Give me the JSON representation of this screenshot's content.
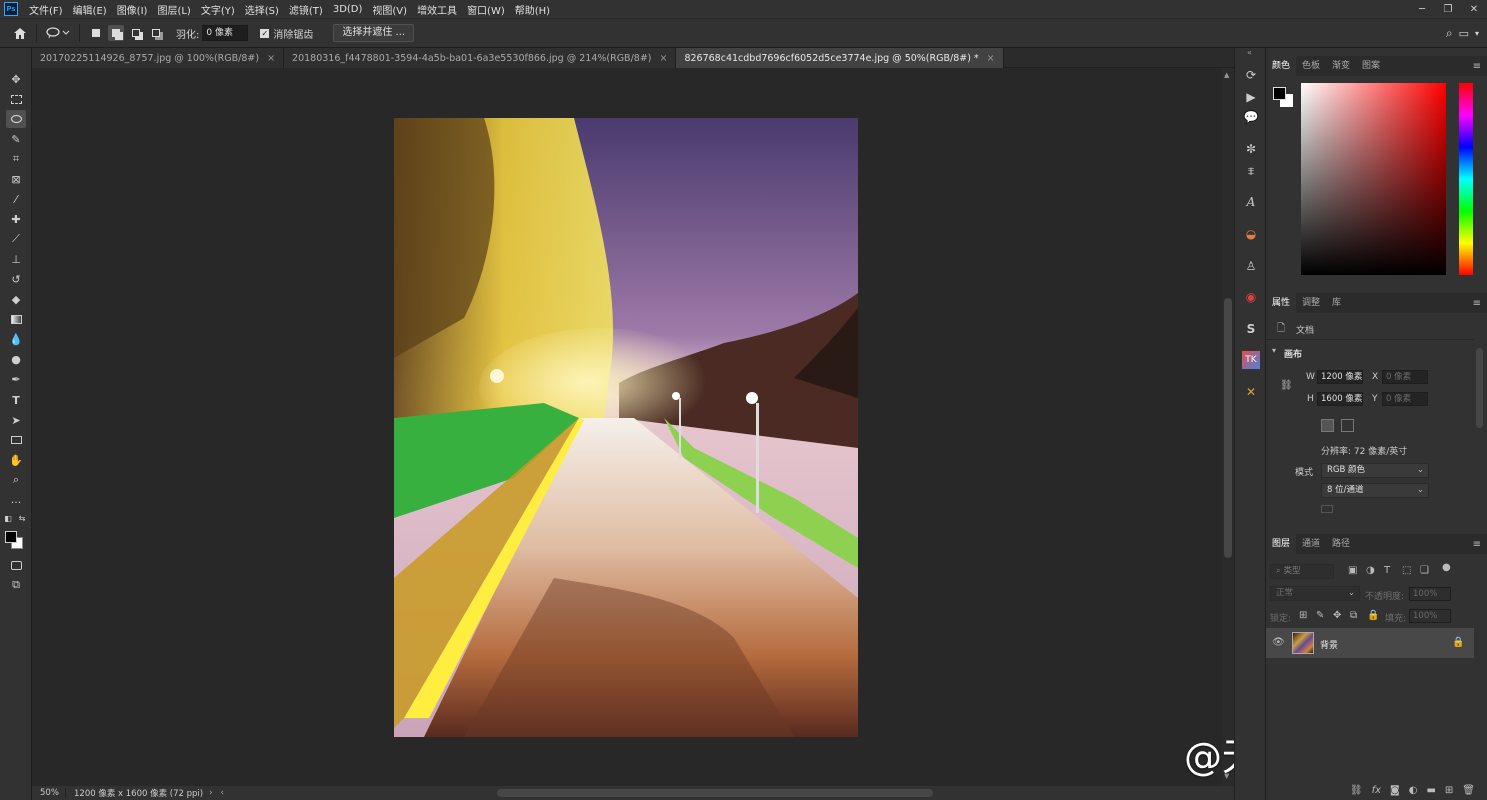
{
  "app": {
    "logo": "Ps"
  },
  "menu": [
    "文件(F)",
    "编辑(E)",
    "图像(I)",
    "图层(L)",
    "文字(Y)",
    "选择(S)",
    "滤镜(T)",
    "3D(D)",
    "视图(V)",
    "增效工具",
    "窗口(W)",
    "帮助(H)"
  ],
  "options": {
    "feather_label": "羽化:",
    "feather_value": "0 像素",
    "antialias_label": "消除锯齿",
    "select_mask_button": "选择并遮住 ..."
  },
  "tabs": [
    {
      "label": "20170225114926_8757.jpg @ 100%(RGB/8#)",
      "close": "×"
    },
    {
      "label": "20180316_f4478801-3594-4a5b-ba01-6a3e5530f866.jpg @ 214%(RGB/8#)",
      "close": "×"
    },
    {
      "label": "826768c41cdbd7696cf6052d5ce3774e.jpg @ 50%(RGB/8#) *",
      "close": "×"
    }
  ],
  "status": {
    "zoom": "50%",
    "doc_info": "1200 像素 x 1600 像素 (72 ppi)"
  },
  "watermark": "@无情肉垫猫",
  "color_panel": {
    "tabs": [
      "颜色",
      "色板",
      "渐变",
      "图案"
    ]
  },
  "properties_panel": {
    "tabs": [
      "属性",
      "调整",
      "库"
    ],
    "doc_label": "文档",
    "canvas_section": "画布",
    "w_label": "W",
    "w_value": "1200 像素",
    "h_label": "H",
    "h_value": "1600 像素",
    "x_label": "X",
    "x_value": "0 像素",
    "y_label": "Y",
    "y_value": "0 像素",
    "resolution": "分辨率: 72 像素/英寸",
    "mode_label": "模式",
    "mode_value": "RGB 颜色",
    "depth_value": "8 位/通道"
  },
  "layers_panel": {
    "tabs": [
      "图层",
      "通道",
      "路径"
    ],
    "filter_placeholder": "类型",
    "blend_mode": "正常",
    "opacity_label": "不透明度:",
    "opacity_value": "100%",
    "lock_label": "锁定:",
    "fill_label": "填充:",
    "fill_value": "100%",
    "layer_name": "背景"
  }
}
